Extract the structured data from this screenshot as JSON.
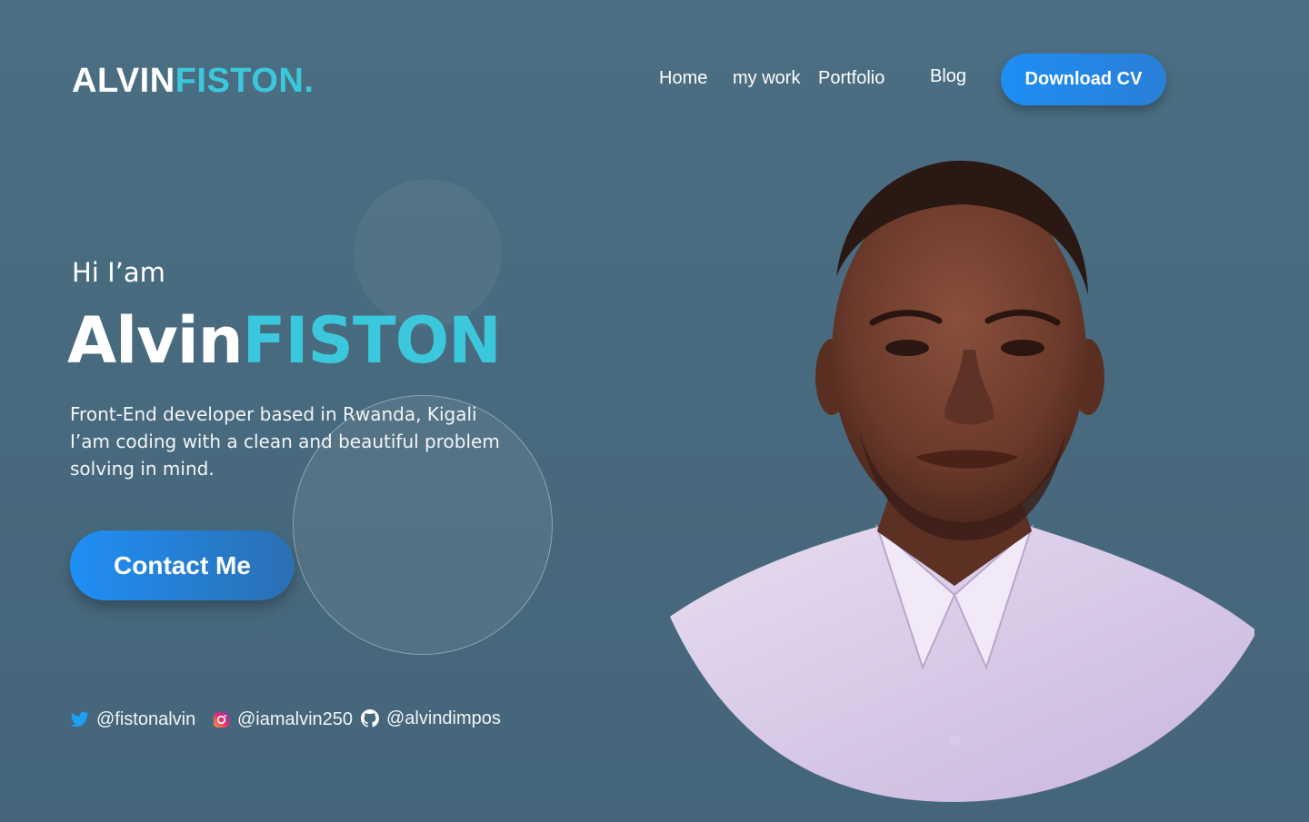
{
  "logo": {
    "first": "ALVIN",
    "second": "FISTON."
  },
  "nav": {
    "items": [
      "Home",
      "my work",
      "Portfolio",
      "Blog"
    ],
    "cta": "Download CV"
  },
  "hero": {
    "greeting": "Hi I’am",
    "name_first": "Alvin",
    "name_second": "FISTON",
    "description_lines": [
      "Front-End developer based in Rwanda, Kigali",
      "I’am coding with a clean and beautiful problem",
      "solving in mind."
    ],
    "contact_button": "Contact Me"
  },
  "socials": [
    {
      "icon": "twitter-icon",
      "handle": "@fistonalvin"
    },
    {
      "icon": "instagram-icon",
      "handle": "@iamalvin250"
    },
    {
      "icon": "github-icon",
      "handle": "@alvindimpos"
    }
  ],
  "colors": {
    "background": "#4b6e82",
    "accent": "#3cc8dc",
    "button": "#1e8ef5"
  }
}
